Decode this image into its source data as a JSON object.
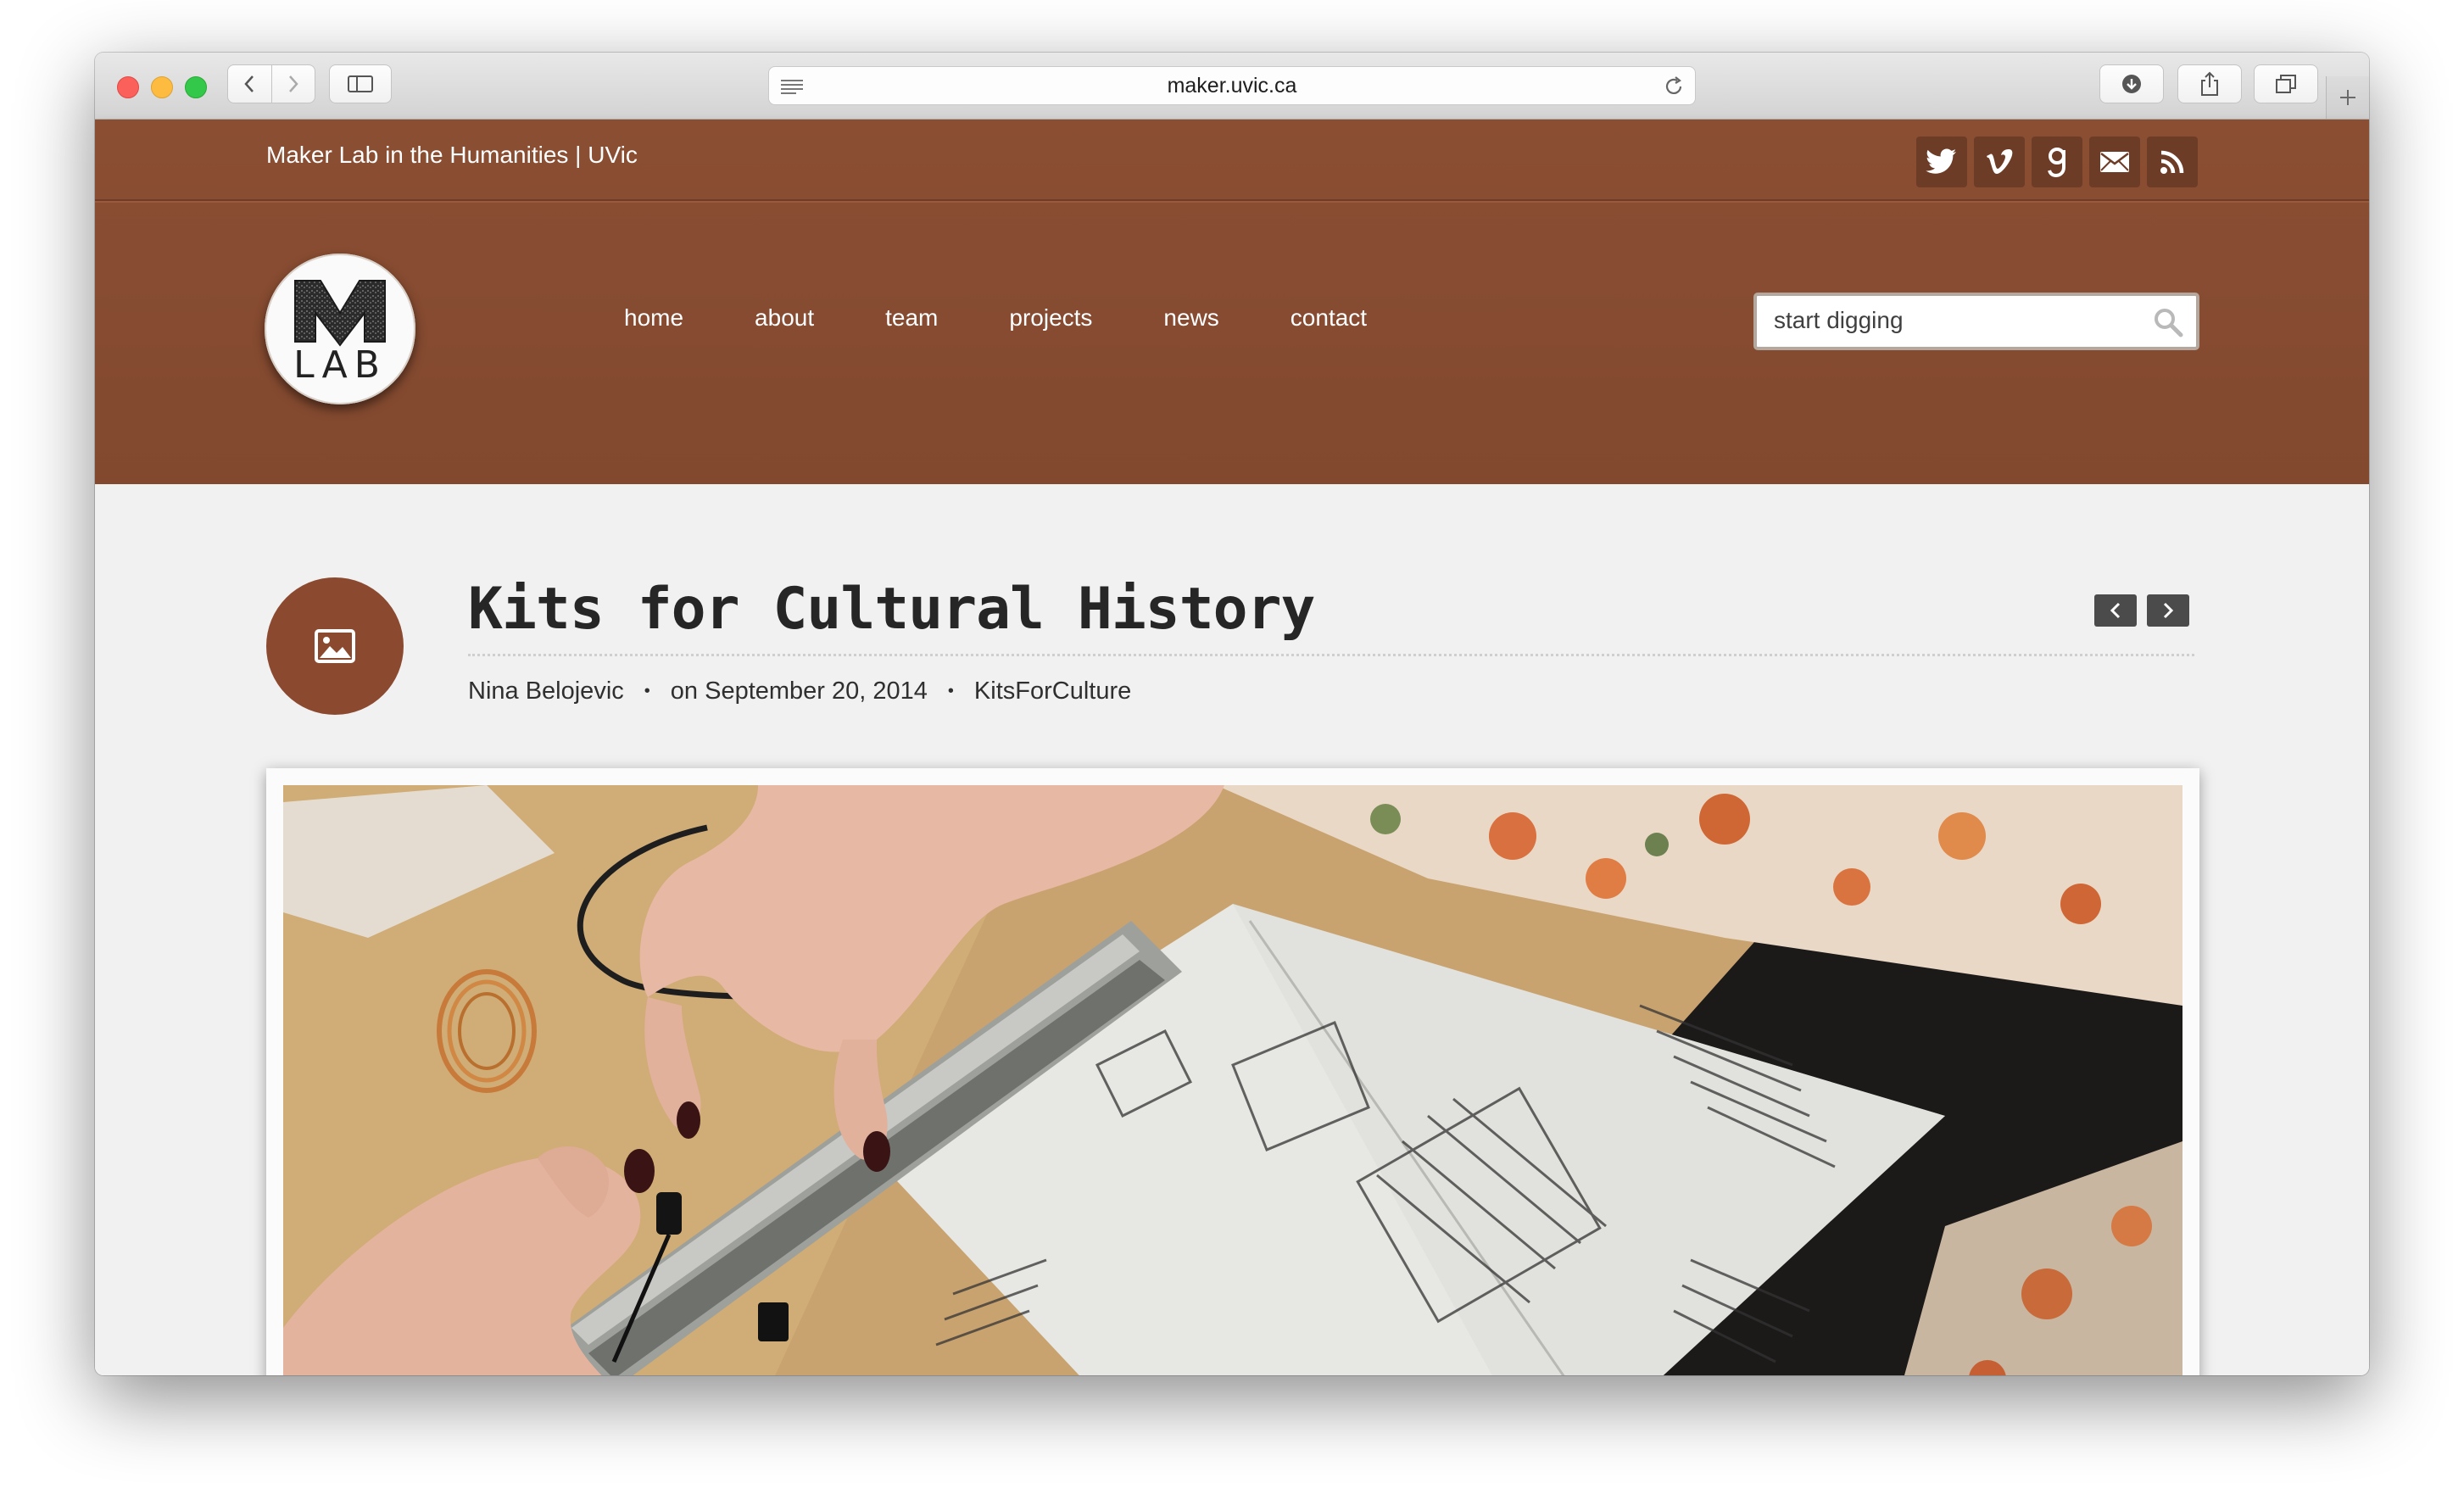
{
  "browser": {
    "url": "maker.uvic.ca"
  },
  "site": {
    "name": "Maker Lab in the Humanities | UVic",
    "logo_text": "LAB",
    "logo_letter": "M",
    "social": [
      "twitter-icon",
      "vimeo-icon",
      "goodreads-icon",
      "mail-icon",
      "rss-icon"
    ],
    "nav": [
      "home",
      "about",
      "team",
      "projects",
      "news",
      "contact"
    ],
    "search_placeholder": "start digging"
  },
  "post": {
    "title": "Kits for Cultural History",
    "author": "Nina Belojevic",
    "date": "on September 20, 2014",
    "category": "KitsForCulture",
    "meta_sep": "•"
  },
  "colors": {
    "header_brown": "#8b4e33",
    "icon_brown": "#6d3c27",
    "post_icon": "#8b4a30"
  }
}
